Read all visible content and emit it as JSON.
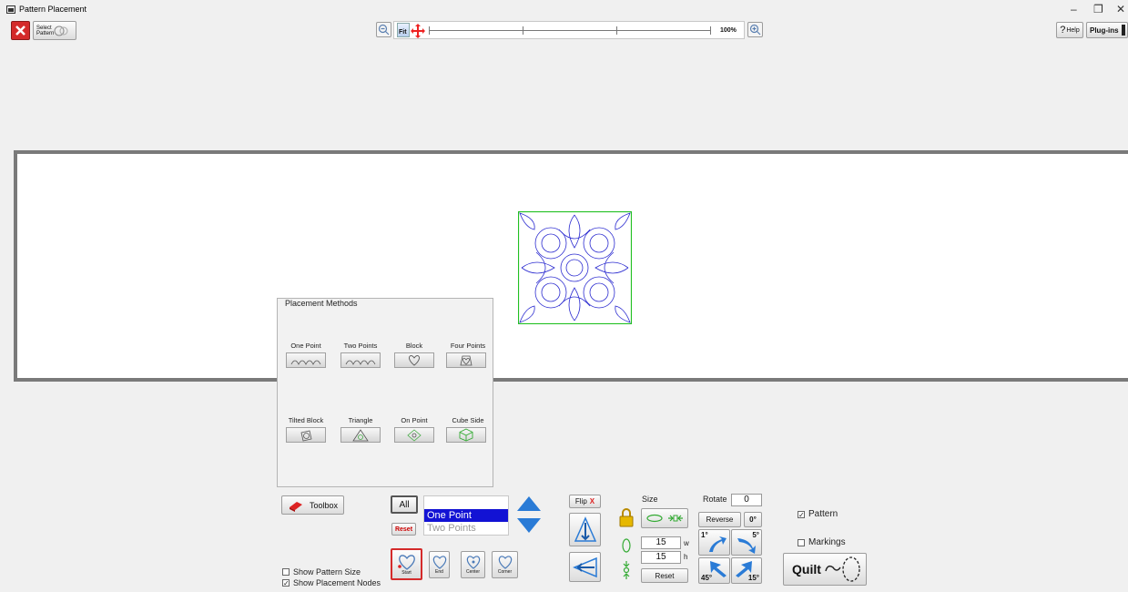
{
  "window": {
    "title": "Pattern Placement",
    "minimize": "–",
    "restore": "❐",
    "close": "✕"
  },
  "toolbar": {
    "select_pattern": "Select Pattern",
    "fit": "Fit",
    "zoom_level": "100%",
    "help": "Help",
    "plugins": "Plug-ins"
  },
  "placement_methods": {
    "title": "Placement Methods",
    "methods": [
      "One Point",
      "Two Points",
      "Block",
      "Four Points",
      "Tilted Block",
      "Triangle",
      "On Point",
      "Cube Side"
    ]
  },
  "controls": {
    "toolbox": "Toolbox",
    "all": "All",
    "reset_small": "Reset",
    "list": [
      {
        "label": "One Point",
        "selected": true
      },
      {
        "label": "Two Points",
        "selected": false
      }
    ],
    "anchors": [
      "Start",
      "End",
      "Center",
      "Corner"
    ],
    "show_pattern_size": "Show Pattern Size",
    "show_pattern_size_checked": false,
    "show_placement_nodes": "Show Placement Nodes",
    "show_placement_nodes_checked": true,
    "flip": "Flip",
    "flip_x": "X",
    "size": "Size",
    "width_value": "15",
    "width_unit": "w",
    "height_value": "15",
    "height_unit": "h",
    "size_reset": "Reset",
    "rotate": "Rotate",
    "rotate_value": "0",
    "reverse": "Reverse",
    "deg_0": "0°",
    "deg_1": "1°",
    "deg_5": "5°",
    "deg_45": "45°",
    "deg_15": "15°",
    "pattern": "Pattern",
    "pattern_checked": true,
    "markings": "Markings",
    "markings_checked": false,
    "quilt": "Quilt"
  },
  "colors": {
    "accent_blue": "#1212d4",
    "arrow_blue": "#2a7bd6",
    "pattern_line": "#2b2bd0",
    "pattern_box": "#22c022",
    "close_red": "#d42a2a"
  }
}
